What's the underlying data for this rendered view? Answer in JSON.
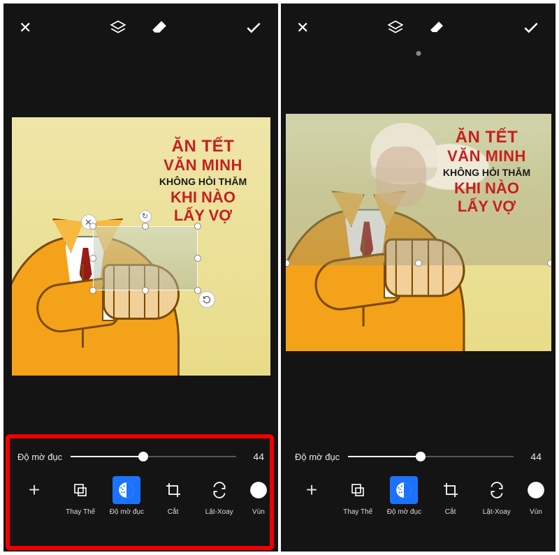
{
  "topbar": {
    "close": "✕",
    "layers": "layers",
    "eraser": "eraser",
    "confirm": "✓"
  },
  "meme_text": {
    "line1": "ĂN TẾT",
    "line2": "VĂN MINH",
    "line3": "KHÔNG HỎI THĂM",
    "line4": "KHI NÀO",
    "line5": "LẤY VỢ"
  },
  "slider": {
    "label": "Độ mờ đục",
    "value": "44",
    "percent": 44
  },
  "tools": {
    "add": "+",
    "replace": "Thay Thế",
    "opacity": "Độ mờ đục",
    "crop": "Cắt",
    "flip": "Lật-Xoay",
    "region": "Vùn"
  }
}
